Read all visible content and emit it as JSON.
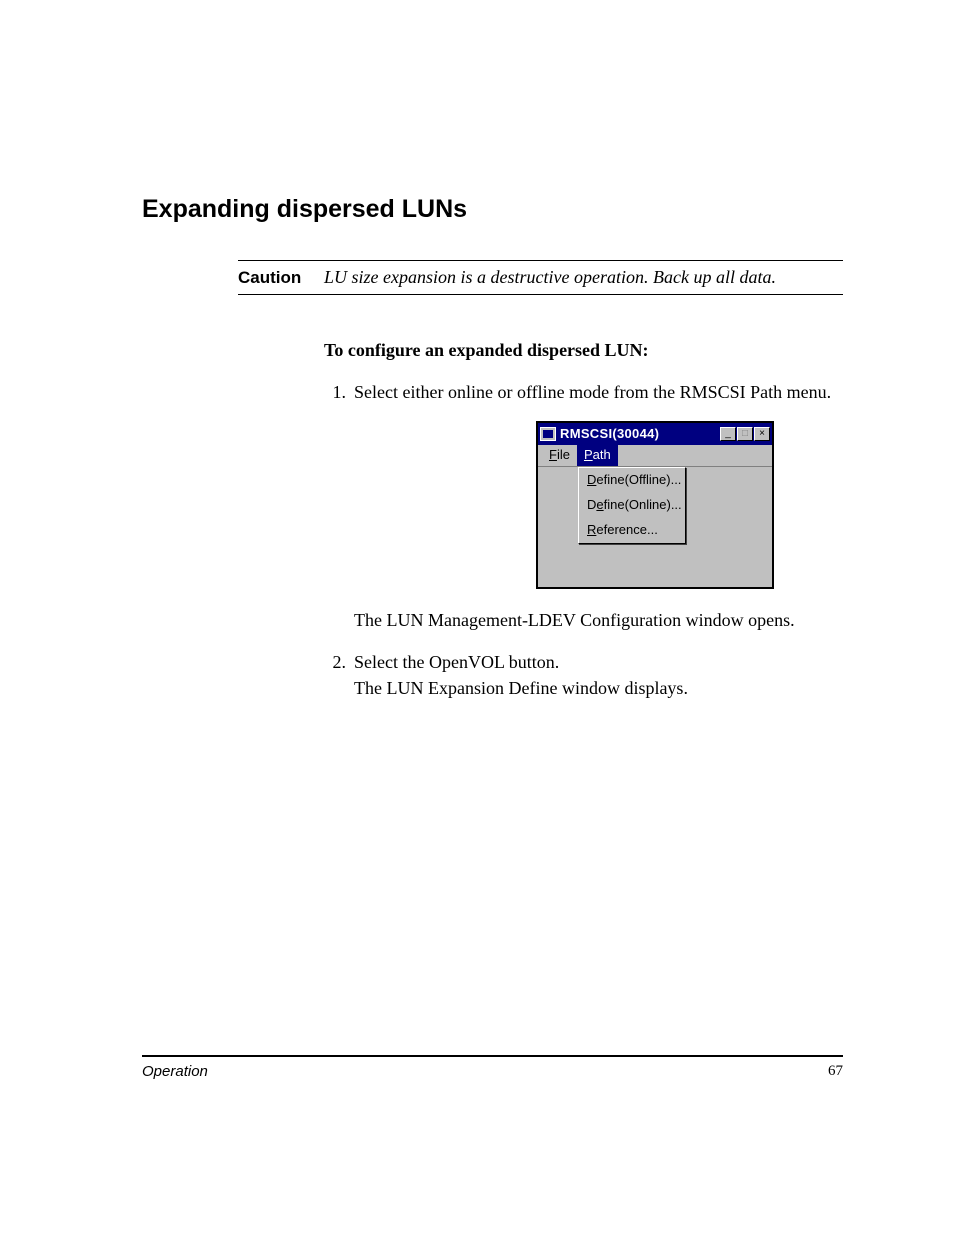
{
  "heading": "Expanding dispersed LUNs",
  "caution": {
    "label": "Caution",
    "text": "LU size expansion is a destructive operation. Back up all data."
  },
  "instructionHeading": "To configure an expanded dispersed LUN:",
  "steps": [
    {
      "num": "1.",
      "text": "Select either online or offline mode from the RMSCSI Path menu.",
      "result": "The LUN Management-LDEV Configuration window opens."
    },
    {
      "num": "2.",
      "text": "Select the OpenVOL button.",
      "result": "The LUN Expansion Define window displays."
    }
  ],
  "dialog": {
    "title": "RMSCSI(30044)",
    "menus": {
      "file": "File",
      "path": "Path"
    },
    "dropdown": [
      "Define(Offline)...",
      "Define(Online)...",
      "Reference..."
    ],
    "controls": {
      "minimize": "_",
      "maximize": "□",
      "close": "×"
    }
  },
  "footer": {
    "section": "Operation",
    "page": "67"
  }
}
